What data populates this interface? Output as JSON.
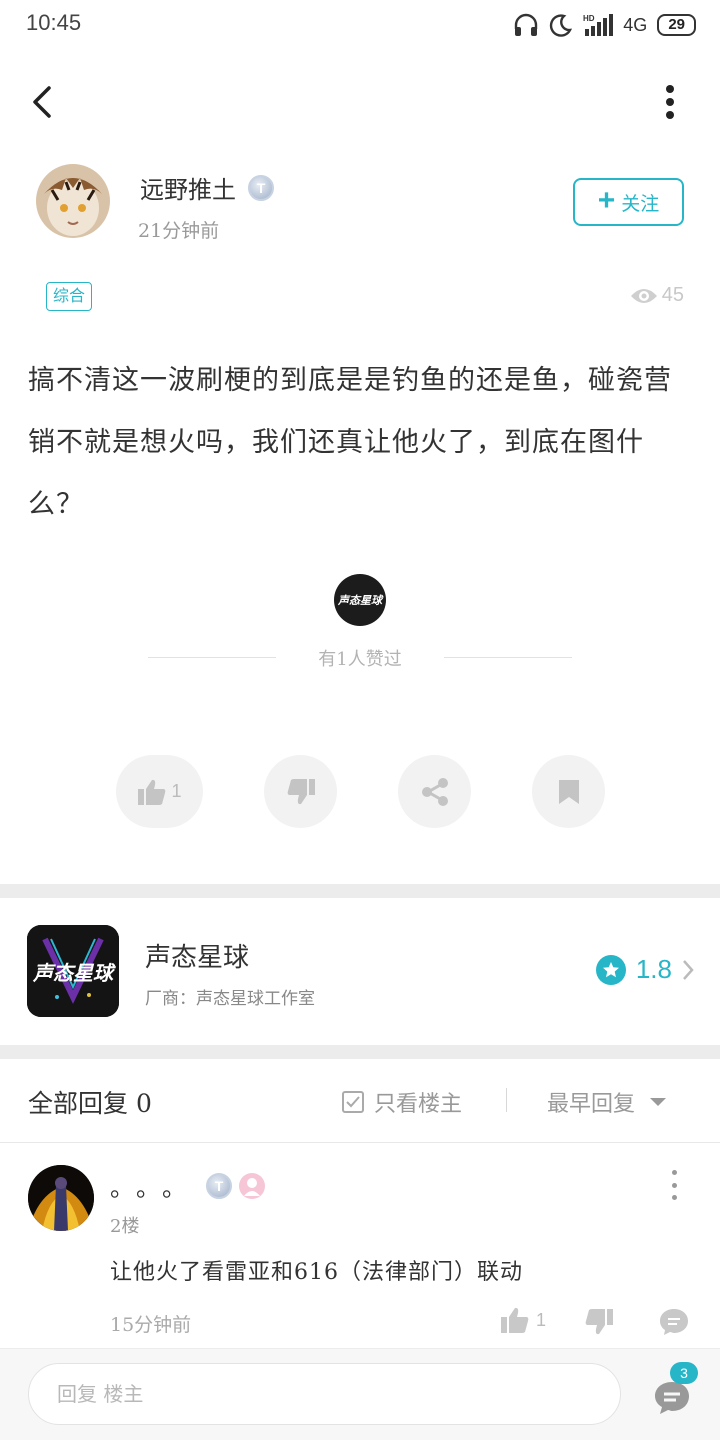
{
  "status_bar": {
    "time": "10:45",
    "network": "4G",
    "battery": "29"
  },
  "post": {
    "author": "远野推土",
    "author_badge": "T",
    "time": "21分钟前",
    "follow_label": "关注",
    "tag": "综合",
    "views": "45",
    "body": "搞不清这一波刷梗的到底是是钓鱼的还是鱼，碰瓷营销不就是想火吗，我们还真让他火了，到底在图什么？",
    "liked_text": "有1人赞过",
    "like_count": "1"
  },
  "app_card": {
    "icon_text": "声态星球",
    "name": "声态星球",
    "vendor": "厂商：声态星球工作室",
    "rating": "1.8"
  },
  "replies": {
    "title": "全部回复 0",
    "op_only_label": "只看楼主",
    "sort_label": "最早回复"
  },
  "comment": {
    "author": "。。。",
    "badge": "T",
    "floor": "2楼",
    "text": "让他火了看雷亚和616（法律部门）联动",
    "time": "15分钟前",
    "like_count": "1"
  },
  "bottom_bar": {
    "input_placeholder": "回复 楼主",
    "comment_count": "3"
  },
  "colors": {
    "accent": "#26b6c8",
    "divider": "#ececec"
  }
}
